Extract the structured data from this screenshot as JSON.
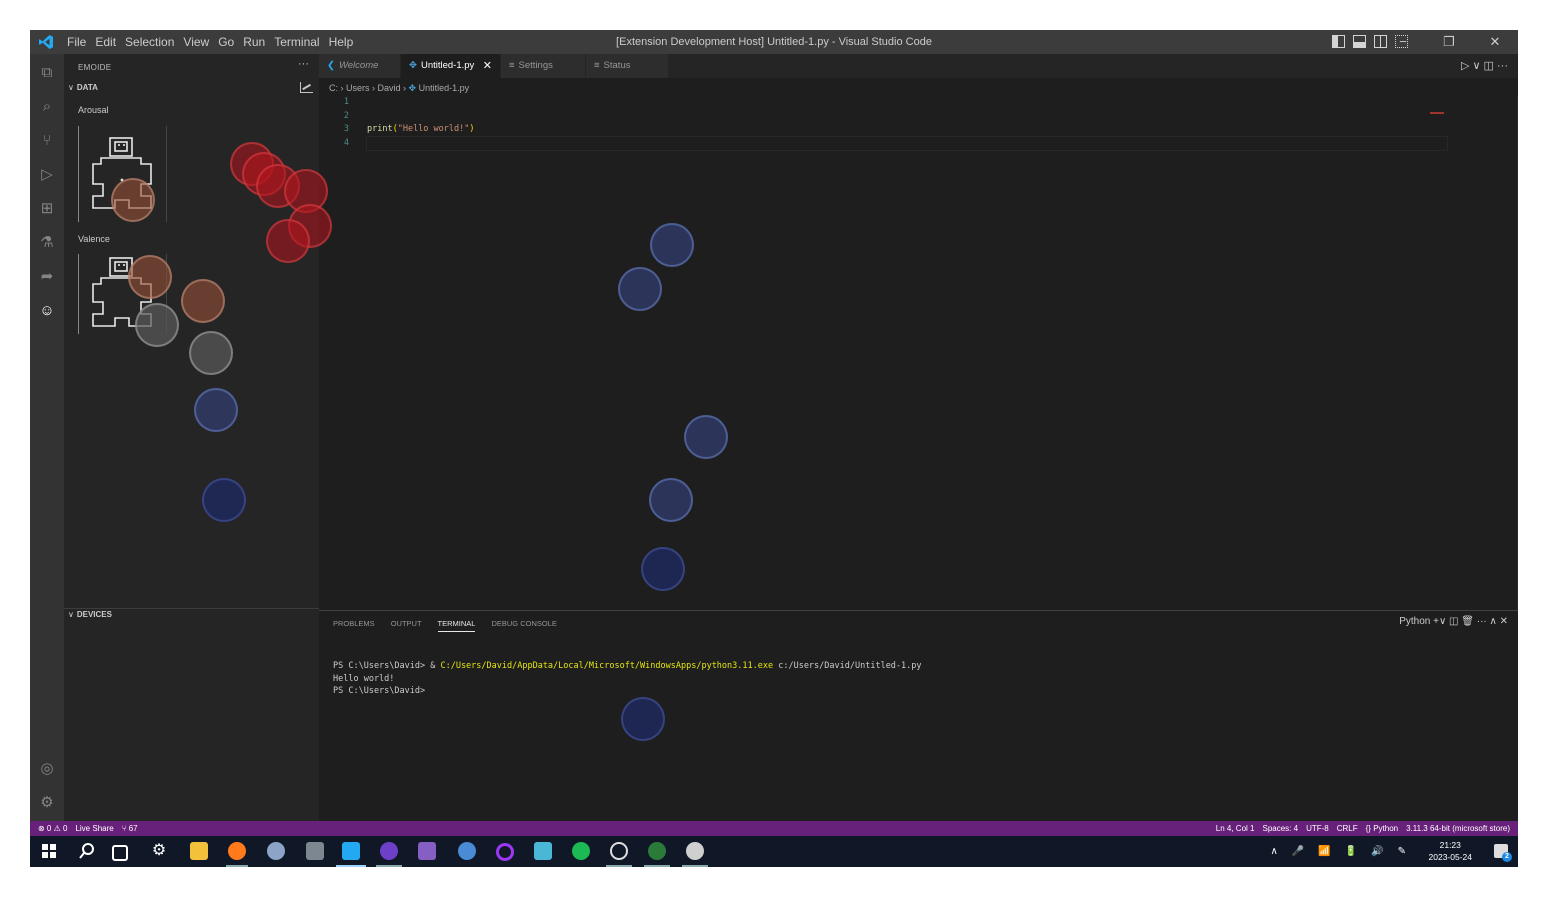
{
  "window": {
    "title": "[Extension Development Host] Untitled-1.py - Visual Studio Code",
    "menu": [
      "File",
      "Edit",
      "Selection",
      "View",
      "Go",
      "Run",
      "Terminal",
      "Help"
    ],
    "controls": {
      "minimize": "−",
      "restore": "❐",
      "close": "✕"
    }
  },
  "activity_bar": {
    "icons": [
      "explorer-icon",
      "search-icon",
      "source-control-icon",
      "run-debug-icon",
      "extensions-icon",
      "testing-icon",
      "live-share-icon",
      "emoide-icon",
      "accounts-icon",
      "manage-gear-icon"
    ]
  },
  "sidebar": {
    "header": "EMOIDE",
    "more": "···",
    "data_section": {
      "title": "DATA",
      "chevron": "∨"
    },
    "labels": {
      "arousal": "Arousal",
      "valence": "Valence"
    },
    "devices_section": {
      "title": "DEVICES",
      "chevron": "∨"
    }
  },
  "tabs": [
    {
      "label": "Welcome",
      "icon": "vscode-icon",
      "active": false
    },
    {
      "label": "Untitled-1.py",
      "icon": "python-file-icon",
      "active": true,
      "close": "✕"
    },
    {
      "label": "Settings",
      "icon": "settings-file-icon",
      "active": false
    },
    {
      "label": "Status",
      "icon": "status-file-icon",
      "active": false
    }
  ],
  "editor_actions": "▷ ∨  ◫  ···",
  "breadcrumb": [
    "C:",
    "Users",
    "David",
    "Untitled-1.py"
  ],
  "editor": {
    "line_numbers": [
      "1",
      "2",
      "3",
      "4"
    ],
    "code": {
      "line3_fn": "print",
      "line3_open": "(",
      "line3_str": "\"Hello world!\"",
      "line3_close": ")"
    }
  },
  "panel": {
    "tabs": [
      "PROBLEMS",
      "OUTPUT",
      "TERMINAL",
      "DEBUG CONSOLE"
    ],
    "active_tab": "TERMINAL",
    "actions": "Python  +∨  ◫  🗑  ···  ∧  ✕",
    "terminal": {
      "line1_prompt": "PS C:\\Users\\David> & ",
      "line1_exe": "C:/Users/David/AppData/Local/Microsoft/WindowsApps/python3.11.exe",
      "line1_arg": " c:/Users/David/Untitled-1.py",
      "line2": "Hello world!",
      "line3": "PS C:\\Users\\David>"
    }
  },
  "status_bar": {
    "left": [
      "⊗ 0 ⚠ 0",
      "Live Share",
      "⑂ 67"
    ],
    "right": [
      "Ln 4, Col 1",
      "Spaces: 4",
      "UTF-8",
      "CRLF",
      "{} Python",
      "3.11.3 64-bit (microsoft store)"
    ]
  },
  "taskbar": {
    "clock_time": "21:23",
    "clock_date": "2023-05-24",
    "notification_count": "2",
    "tray": [
      "∧",
      "🎤",
      "📶",
      "🔋",
      "🔊",
      "✎"
    ]
  },
  "colors": {
    "accent": "#0078d4",
    "status_bar": "#68217a",
    "activity_bar": "#333333",
    "sidebar": "#252526",
    "editor": "#1e1e1e"
  }
}
